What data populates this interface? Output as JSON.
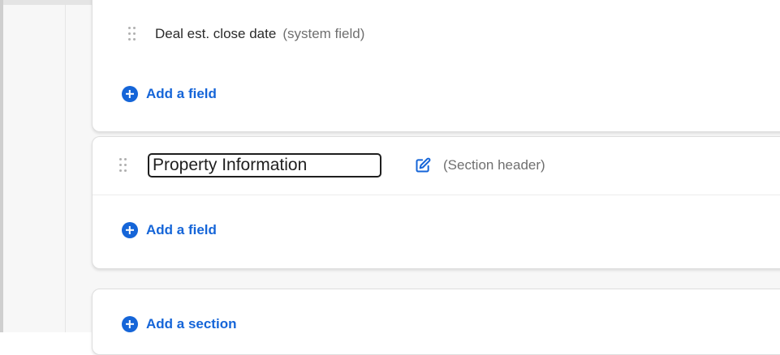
{
  "fields": [
    {
      "name": "Deal est. close date",
      "note": "(system field)"
    }
  ],
  "add_field_label": "Add a field",
  "section": {
    "title_value": "Property Information",
    "note": "(Section header)",
    "add_field_label": "Add a field"
  },
  "add_section_label": "Add a section",
  "colors": {
    "accent": "#1565d8",
    "text": "#2b2b2b",
    "muted": "#6f6f6f"
  },
  "icons": {
    "drag": "drag-handle-icon",
    "edit": "edit-icon",
    "add": "plus-circle-icon"
  }
}
